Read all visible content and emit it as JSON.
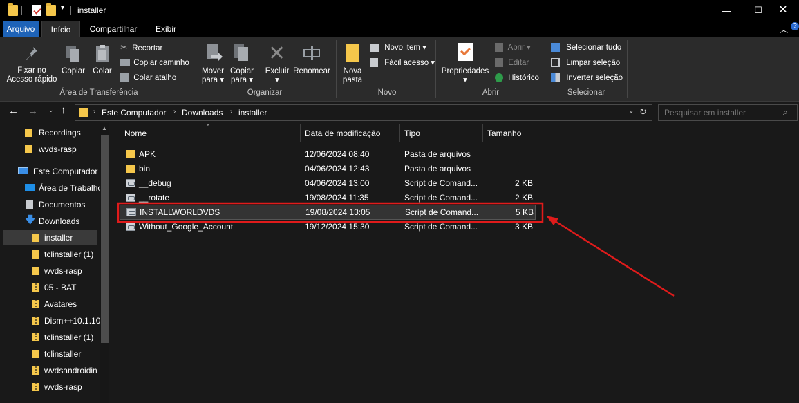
{
  "window": {
    "title": "installer",
    "controls": [
      "minimize",
      "maximize",
      "close"
    ]
  },
  "ribbon_tabs": [
    {
      "label": "Arquivo",
      "type": "file"
    },
    {
      "label": "Início",
      "active": true
    },
    {
      "label": "Compartilhar"
    },
    {
      "label": "Exibir"
    }
  ],
  "ribbon": {
    "clipboard": {
      "group_label": "Área de Transferência",
      "pin_label": "Fixar no\nAcesso rápido",
      "copy_label": "Copiar",
      "paste_label": "Colar",
      "cut_label": "Recortar",
      "copy_path_label": "Copiar caminho",
      "paste_shortcut_label": "Colar atalho"
    },
    "organize": {
      "group_label": "Organizar",
      "move_to_label": "Mover\npara ▾",
      "copy_to_label": "Copiar\npara ▾",
      "delete_label": "Excluir\n▾",
      "rename_label": "Renomear"
    },
    "new": {
      "group_label": "Novo",
      "new_folder_label": "Nova\npasta",
      "new_item_label": "Novo item ▾",
      "easy_access_label": "Fácil acesso ▾"
    },
    "open": {
      "group_label": "Abrir",
      "properties_label": "Propriedades\n▾",
      "open_label": "Abrir ▾",
      "edit_label": "Editar",
      "history_label": "Histórico"
    },
    "select": {
      "group_label": "Selecionar",
      "select_all_label": "Selecionar tudo",
      "select_none_label": "Limpar seleção",
      "invert_label": "Inverter seleção"
    }
  },
  "address": {
    "breadcrumbs": [
      "Este Computador",
      "Downloads",
      "installer"
    ],
    "search_placeholder": "Pesquisar em installer"
  },
  "nav_pane": [
    {
      "label": "Recordings",
      "icon": "folder-icon"
    },
    {
      "label": "wvds-rasp",
      "icon": "folder-icon"
    },
    {
      "label": "Este Computador",
      "icon": "computer-icon"
    },
    {
      "label": "Área de Trabalho",
      "icon": "desktop-icon"
    },
    {
      "label": "Documentos",
      "icon": "documents-icon"
    },
    {
      "label": "Downloads",
      "icon": "download-icon"
    },
    {
      "label": "installer",
      "icon": "folder-icon",
      "selected": true
    },
    {
      "label": "tclinstaller (1)",
      "icon": "folder-icon"
    },
    {
      "label": "wvds-rasp",
      "icon": "folder-icon"
    },
    {
      "label": "05 - BAT",
      "icon": "zip-folder-icon"
    },
    {
      "label": "Avatares",
      "icon": "zip-folder-icon"
    },
    {
      "label": "Dism++10.1.10",
      "icon": "zip-folder-icon"
    },
    {
      "label": "tclinstaller (1)",
      "icon": "zip-folder-icon"
    },
    {
      "label": "tclinstaller",
      "icon": "folder-icon"
    },
    {
      "label": "wvdsandroidin",
      "icon": "zip-folder-icon"
    },
    {
      "label": "wvds-rasp",
      "icon": "zip-folder-icon"
    }
  ],
  "file_list": {
    "columns": [
      "Nome",
      "Data de modificação",
      "Tipo",
      "Tamanho"
    ],
    "rows": [
      {
        "name": "APK",
        "date": "12/06/2024 08:40",
        "type": "Pasta de arquivos",
        "size": "",
        "icon": "folder-icon"
      },
      {
        "name": "bin",
        "date": "04/06/2024 12:43",
        "type": "Pasta de arquivos",
        "size": "",
        "icon": "folder-icon"
      },
      {
        "name": "__debug",
        "date": "04/06/2024 13:00",
        "type": "Script de Comand...",
        "size": "2 KB",
        "icon": "script-icon"
      },
      {
        "name": "__rotate",
        "date": "19/08/2024 11:35",
        "type": "Script de Comand...",
        "size": "2 KB",
        "icon": "script-icon"
      },
      {
        "name": "INSTALLWORLDVDS",
        "date": "19/08/2024 13:05",
        "type": "Script de Comand...",
        "size": "5 KB",
        "icon": "script-icon",
        "highlighted": true
      },
      {
        "name": "Without_Google_Account",
        "date": "19/12/2024 15:30",
        "type": "Script de Comand...",
        "size": "3 KB",
        "icon": "script-icon"
      }
    ]
  },
  "annotation": {
    "color": "#e01b1b",
    "shape": "rectangle-and-arrow"
  }
}
